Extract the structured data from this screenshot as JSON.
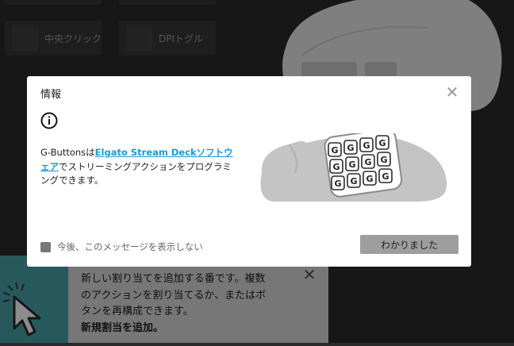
{
  "background": {
    "tiles": [
      {
        "label": ""
      },
      {
        "label": ""
      },
      {
        "label": "中央クリック"
      },
      {
        "label": "DPIトグル"
      }
    ]
  },
  "notice": {
    "line1": "新しい割り当てを追加する番です。複数",
    "line2": "のアクションを割り当てるか、またはボ",
    "line3": "タンを再構成できます。",
    "line4": "新規割当を追加。",
    "close_icon": "close-icon",
    "accent_color": "#47a3a8"
  },
  "dialog": {
    "title": "情報",
    "body_prefix": "G-Buttonsは",
    "link_text": "Elgato Stream Deckソフトウェア",
    "body_suffix": "でストリーミングアクションをプログラミングできます。",
    "keypad_letter": "G",
    "checkbox_label": "今後、このメッセージを表示しない",
    "ok_label": "わかりました",
    "link_color": "#1a9ad6"
  }
}
